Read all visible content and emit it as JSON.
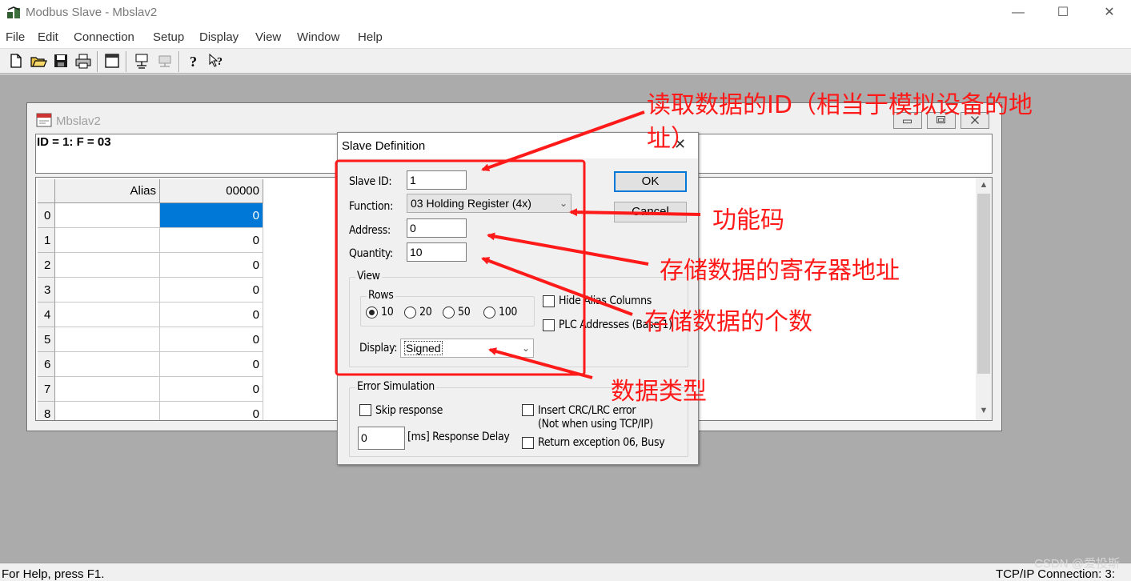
{
  "app": {
    "title": "Modbus Slave - Mbslav2",
    "minimize_glyph": "—",
    "maximize_glyph": "☐",
    "close_glyph": "✕"
  },
  "menu": [
    "File",
    "Edit",
    "Connection",
    "Setup",
    "Display",
    "View",
    "Window",
    "Help"
  ],
  "toolbar": {
    "icons": [
      "new-icon",
      "open-icon",
      "save-icon",
      "print-icon",
      "window-icon",
      "connect-icon",
      "disconnect-icon",
      "help-icon",
      "context-help-icon"
    ]
  },
  "child_window": {
    "title": "Mbslav2",
    "status_text": "ID = 1: F = 03",
    "grid": {
      "headers": [
        "Alias",
        "00000"
      ],
      "rows": [
        {
          "num": "0",
          "alias": "",
          "value": "0"
        },
        {
          "num": "1",
          "alias": "",
          "value": "0"
        },
        {
          "num": "2",
          "alias": "",
          "value": "0"
        },
        {
          "num": "3",
          "alias": "",
          "value": "0"
        },
        {
          "num": "4",
          "alias": "",
          "value": "0"
        },
        {
          "num": "5",
          "alias": "",
          "value": "0"
        },
        {
          "num": "6",
          "alias": "",
          "value": "0"
        },
        {
          "num": "7",
          "alias": "",
          "value": "0"
        },
        {
          "num": "8",
          "alias": "",
          "value": "0"
        }
      ],
      "selected_row": 0
    }
  },
  "dialog": {
    "title": "Slave Definition",
    "close_glyph": "✕",
    "slave_id_label": "Slave ID:",
    "slave_id_value": "1",
    "function_label": "Function:",
    "function_value": "03 Holding Register (4x)",
    "address_label": "Address:",
    "address_value": "0",
    "quantity_label": "Quantity:",
    "quantity_value": "10",
    "ok_label": "OK",
    "cancel_label": "Cancel",
    "view_label": "View",
    "rows_label": "Rows",
    "row_options": [
      {
        "label": "10",
        "checked": true
      },
      {
        "label": "20",
        "checked": false
      },
      {
        "label": "50",
        "checked": false
      },
      {
        "label": "100",
        "checked": false
      }
    ],
    "hide_alias_label": "Hide Alias Columns",
    "plc_addresses_label": "PLC Addresses (Base 1)",
    "display_label": "Display:",
    "display_value": "Signed",
    "error_sim_label": "Error Simulation",
    "skip_response_label": "Skip response",
    "insert_crc_label": "Insert CRC/LRC error",
    "insert_crc_note": "(Not when using TCP/IP)",
    "response_delay_value": "0",
    "response_delay_label": "[ms] Response Delay",
    "return_exception_label": "Return exception 06, Busy"
  },
  "status_bar": {
    "left": "For Help, press F1.",
    "right": "TCP/IP Connection: 3:"
  },
  "watermark": "CSDN @爱投斯",
  "annotations": {
    "color": "#ff1a1a",
    "slave_id_line1": "读取数据的ID（相当于模拟设备的地",
    "slave_id_line2": "址）",
    "function_code": "功能码",
    "register_address": "存储数据的寄存器地址",
    "quantity": "存储数据的个数",
    "data_type": "数据类型"
  }
}
